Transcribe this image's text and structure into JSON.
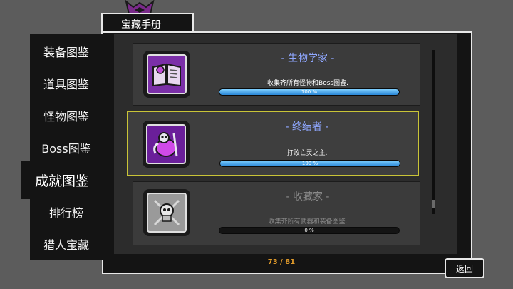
{
  "header": {
    "title": "宝藏手册"
  },
  "sidebar": {
    "items": [
      {
        "label": "装备图鉴"
      },
      {
        "label": "道具图鉴"
      },
      {
        "label": "怪物图鉴"
      },
      {
        "label": "Boss图鉴"
      },
      {
        "label": "成就图鉴"
      },
      {
        "label": "排行榜"
      },
      {
        "label": "猎人宝藏"
      }
    ],
    "active_index": 4
  },
  "achievements": [
    {
      "name": "- 生物学家 -",
      "description": "收集齐所有怪物和Boss图鉴.",
      "progress_text": "100 %",
      "progress": 1.0,
      "icon": "spellbook-icon",
      "completed": true
    },
    {
      "name": "- 终结者 -",
      "description": "打败亡灵之主.",
      "progress_text": "100 %",
      "progress": 1.0,
      "icon": "undead-lord-icon",
      "completed": true
    },
    {
      "name": "- 收藏家 -",
      "description": "收集齐所有武器和装备图鉴.",
      "progress_text": "0 %",
      "progress": 0.0,
      "icon": "skull-crossed-weapons-icon",
      "completed": false
    }
  ],
  "footer": {
    "counter": "73 / 81",
    "back_label": "返回"
  },
  "colors": {
    "accent_blue": "#8fa7ff",
    "highlight_border": "#c9c437",
    "counter_orange": "#e09a2a"
  }
}
